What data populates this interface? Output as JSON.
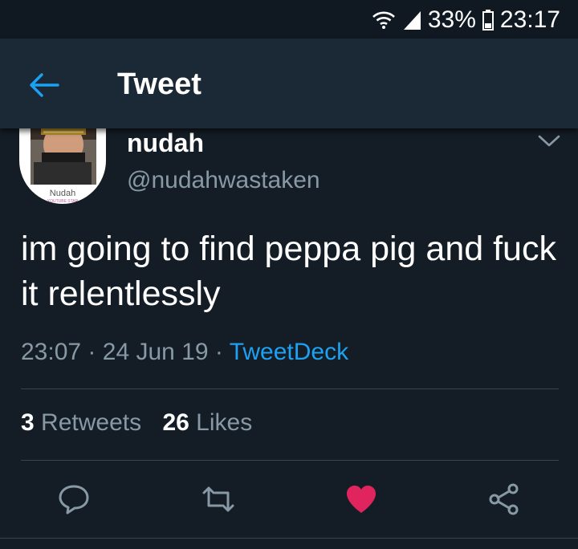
{
  "status_bar": {
    "icons": [
      "wifi-icon",
      "signal-icon",
      "battery-icon"
    ],
    "battery": "33%",
    "time": "23:17"
  },
  "app_bar": {
    "back_icon": "arrow-left-icon",
    "title": "Tweet"
  },
  "tweet": {
    "author": {
      "display_name": "nudah",
      "handle": "@nudahwastaken",
      "avatar_caption": "Nudah",
      "avatar_subcaption": "YOUTUBE STAR"
    },
    "menu_icon": "chevron-down-icon",
    "text": "im going to find peppa pig and fuck it relentlessly",
    "time": "23:07",
    "separator": "·",
    "date": "24 Jun 19",
    "client": "TweetDeck",
    "retweets_count": "3",
    "retweets_label": "Retweets",
    "likes_count": "26",
    "likes_label": "Likes"
  },
  "actions": [
    {
      "icon": "reply-icon"
    },
    {
      "icon": "retweet-icon"
    },
    {
      "icon": "like-heart-icon",
      "active": true
    },
    {
      "icon": "share-icon"
    }
  ],
  "colors": {
    "background": "#141d26",
    "app_bar": "#1b2836",
    "accent": "#1da1f2",
    "secondary_text": "#8899a6",
    "like": "#e0245e"
  }
}
